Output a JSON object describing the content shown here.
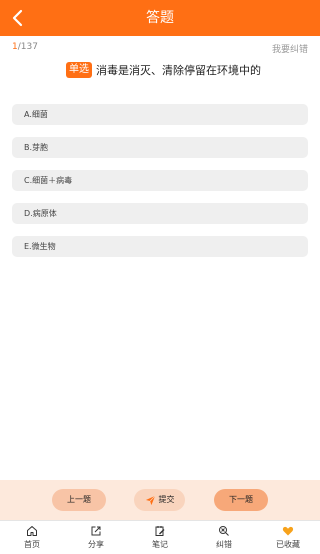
{
  "header": {
    "title": "答题"
  },
  "meta": {
    "current": "1",
    "total": "/137",
    "report_label": "我要纠错"
  },
  "question": {
    "type_badge": "单选",
    "text": "消毒是消灭、清除停留在环境中的"
  },
  "options": [
    {
      "label": "A.细菌"
    },
    {
      "label": "B.芽胞"
    },
    {
      "label": "C.细菌＋病毒"
    },
    {
      "label": "D.病原体"
    },
    {
      "label": "E.微生物"
    }
  ],
  "actions": {
    "prev_label": "上一题",
    "submit_label": "提交",
    "next_label": "下一题"
  },
  "tabs": [
    {
      "label": "首页",
      "icon": "home-icon"
    },
    {
      "label": "分享",
      "icon": "share-icon"
    },
    {
      "label": "笔记",
      "icon": "notes-icon"
    },
    {
      "label": "纠错",
      "icon": "error-search-icon"
    },
    {
      "label": "已收藏",
      "icon": "heart-icon"
    }
  ],
  "colors": {
    "accent": "#ff6f14",
    "favorite": "#f7a21b"
  }
}
